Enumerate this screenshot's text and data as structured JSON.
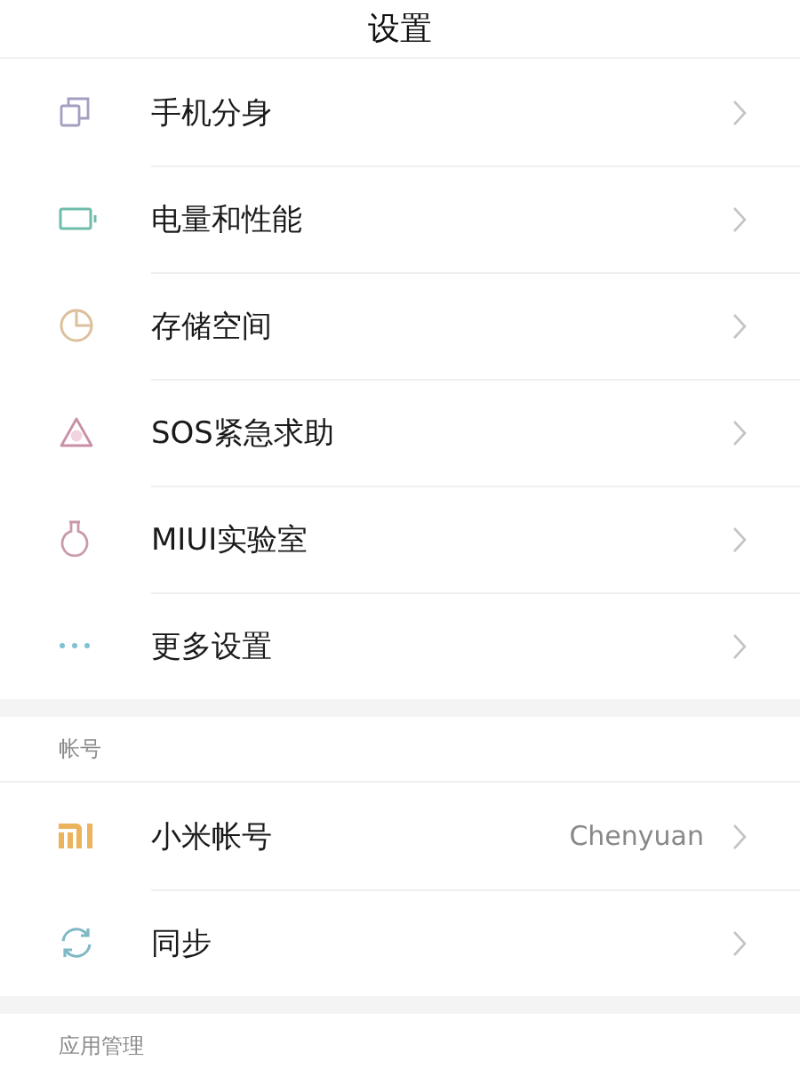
{
  "header": {
    "title": "设置"
  },
  "groups": [
    {
      "items": [
        {
          "kind": "clone",
          "label": "手机分身"
        },
        {
          "kind": "battery",
          "label": "电量和性能"
        },
        {
          "kind": "pie",
          "label": "存储空间"
        },
        {
          "kind": "sos",
          "label": "SOS紧急求助"
        },
        {
          "kind": "flask",
          "label": "MIUI实验室"
        },
        {
          "kind": "dots",
          "label": "更多设置"
        }
      ]
    },
    {
      "title": "帐号",
      "items": [
        {
          "kind": "mi",
          "label": "小米帐号",
          "value": "Chenyuan"
        },
        {
          "kind": "sync",
          "label": "同步"
        }
      ]
    },
    {
      "title": "应用管理"
    }
  ]
}
